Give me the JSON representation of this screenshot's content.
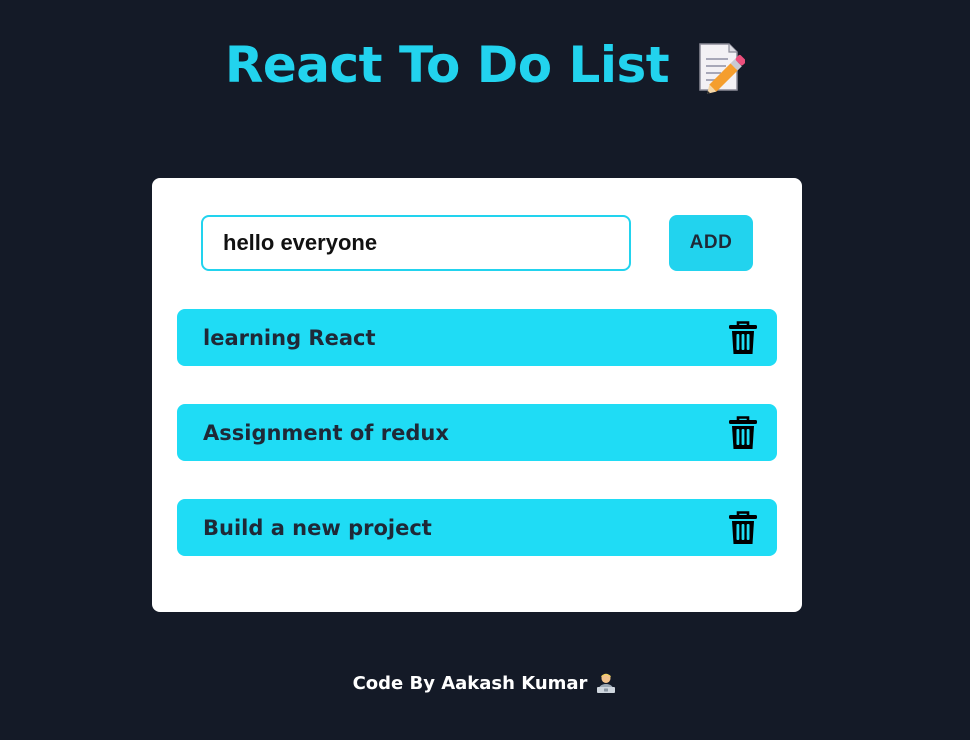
{
  "header": {
    "title": "React To Do List",
    "title_icon": "memo-icon",
    "accent_color": "#22d3ee"
  },
  "input": {
    "value": "hello everyone",
    "placeholder": ""
  },
  "add_button": {
    "label": "ADD"
  },
  "todos": [
    {
      "text": "learning React",
      "icon": "trash-icon"
    },
    {
      "text": "Assignment of redux",
      "icon": "trash-icon"
    },
    {
      "text": "Build a new project",
      "icon": "trash-icon"
    }
  ],
  "footer": {
    "text": "Code By Aakash Kumar",
    "icon": "technologist-icon"
  },
  "colors": {
    "background": "#141a27",
    "card": "#ffffff",
    "item": "#1fdcf5",
    "item_text": "#1f2937"
  }
}
